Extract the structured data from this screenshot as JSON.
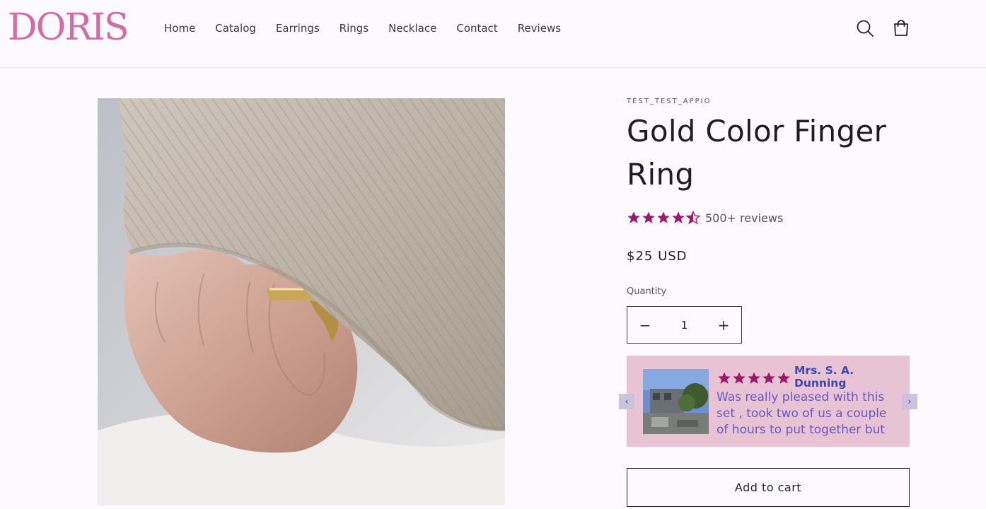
{
  "brand": {
    "logo_text": "DORIS",
    "accent": "#d46aa6"
  },
  "nav": {
    "items": [
      {
        "label": "Home"
      },
      {
        "label": "Catalog"
      },
      {
        "label": "Earrings"
      },
      {
        "label": "Rings"
      },
      {
        "label": "Necklace"
      },
      {
        "label": "Contact"
      },
      {
        "label": "Reviews"
      }
    ]
  },
  "header_icons": {
    "search": "search-icon",
    "cart": "cart-icon"
  },
  "product": {
    "vendor": "TEST_TEST_APPIO",
    "title": "Gold Color Finger Ring",
    "rating": 4.5,
    "rating_max": 5,
    "reviews_label": "500+ reviews",
    "price": "$25 USD",
    "quantity_label": "Quantity",
    "quantity_value": "1",
    "decrease_symbol": "−",
    "increase_symbol": "+",
    "add_to_cart_label": "Add to cart",
    "star_color": "#a0176f"
  },
  "review_widget": {
    "reviewer": "Mrs. S. A. Dunning",
    "stars": 5,
    "text": "Was really pleased with this set , took two of us a couple of hours to put together but loo…",
    "prev_arrow": "‹",
    "next_arrow": "›",
    "background": "#e8c3d3",
    "name_color": "#3d46b5",
    "text_color": "#6b56c6"
  }
}
